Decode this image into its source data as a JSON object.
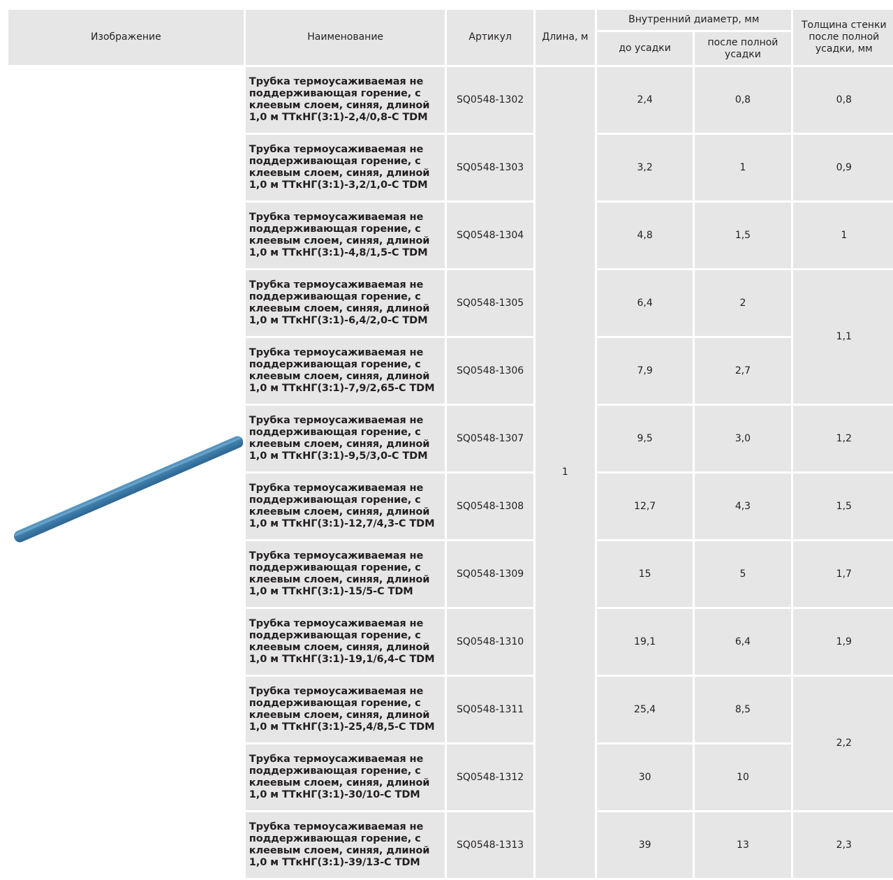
{
  "headers": {
    "image": "Изображение",
    "name": "Наименование",
    "article": "Артикул",
    "length": "Длина, м",
    "inner_diameter": "Внутренний диаметр, мм",
    "before_shrink": "до усадки",
    "after_shrink": "после полной усадки",
    "wall_thickness": "Толщина стенки после полной усадки, мм"
  },
  "length_value": "1",
  "tube_color": "#3e7eab",
  "rows": [
    {
      "name": "Трубка термоусаживаемая не поддерживающая горение, с клеевым слоем, синяя, длиной 1,0 м ТТкНГ(3:1)-2,4/0,8-С TDM",
      "article": "SQ0548-1302",
      "before": "2,4",
      "after": "0,8",
      "wall": "0,8"
    },
    {
      "name": "Трубка термоусаживаемая не поддерживающая горение, с клеевым слоем, синяя, длиной 1,0 м ТТкНГ(3:1)-3,2/1,0-С TDM",
      "article": "SQ0548-1303",
      "before": "3,2",
      "after": "1",
      "wall": "0,9"
    },
    {
      "name": "Трубка термоусаживаемая не поддерживающая горение, с клеевым слоем, синяя, длиной 1,0 м ТТкНГ(3:1)-4,8/1,5-С TDM",
      "article": "SQ0548-1304",
      "before": "4,8",
      "after": "1,5",
      "wall": "1"
    },
    {
      "name": "Трубка термоусаживаемая не поддерживающая горение, с клеевым слоем, синяя, длиной 1,0 м ТТкНГ(3:1)-6,4/2,0-С TDM",
      "article": "SQ0548-1305",
      "before": "6,4",
      "after": "2",
      "wall": "1,1"
    },
    {
      "name": "Трубка термоусаживаемая не поддерживающая горение, с клеевым слоем, синяя, длиной 1,0 м ТТкНГ(3:1)-7,9/2,65-С TDM",
      "article": "SQ0548-1306",
      "before": "7,9",
      "after": "2,7",
      "wall": null
    },
    {
      "name": "Трубка термоусаживаемая не поддерживающая горение, с клеевым слоем, синяя, длиной 1,0 м ТТкНГ(3:1)-9,5/3,0-С TDM",
      "article": "SQ0548-1307",
      "before": "9,5",
      "after": "3,0",
      "wall": "1,2"
    },
    {
      "name": "Трубка термоусаживаемая не поддерживающая горение, с клеевым слоем, синяя, длиной 1,0 м ТТкНГ(3:1)-12,7/4,3-С TDM",
      "article": "SQ0548-1308",
      "before": "12,7",
      "after": "4,3",
      "wall": "1,5"
    },
    {
      "name": "Трубка термоусаживаемая не поддерживающая горение, с клеевым слоем, синяя, длиной 1,0 м ТТкНГ(3:1)-15/5-С TDM",
      "article": "SQ0548-1309",
      "before": "15",
      "after": "5",
      "wall": "1,7"
    },
    {
      "name": "Трубка термоусаживаемая не поддерживающая горение, с клеевым слоем, синяя, длиной 1,0 м ТТкНГ(3:1)-19,1/6,4-С TDM",
      "article": "SQ0548-1310",
      "before": "19,1",
      "after": "6,4",
      "wall": "1,9"
    },
    {
      "name": "Трубка термоусаживаемая не поддерживающая горение, с клеевым слоем, синяя, длиной 1,0 м ТТкНГ(3:1)-25,4/8,5-С TDM",
      "article": "SQ0548-1311",
      "before": "25,4",
      "after": "8,5",
      "wall": "2,2"
    },
    {
      "name": "Трубка термоусаживаемая не поддерживающая горение, с клеевым слоем, синяя, длиной 1,0 м ТТкНГ(3:1)-30/10-С TDM",
      "article": "SQ0548-1312",
      "before": "30",
      "after": "10",
      "wall": null
    },
    {
      "name": "Трубка термоусаживаемая не поддерживающая горение, с клеевым слоем, синяя, длиной 1,0 м ТТкНГ(3:1)-39/13-С TDM",
      "article": "SQ0548-1313",
      "before": "39",
      "after": "13",
      "wall": "2,3"
    }
  ]
}
